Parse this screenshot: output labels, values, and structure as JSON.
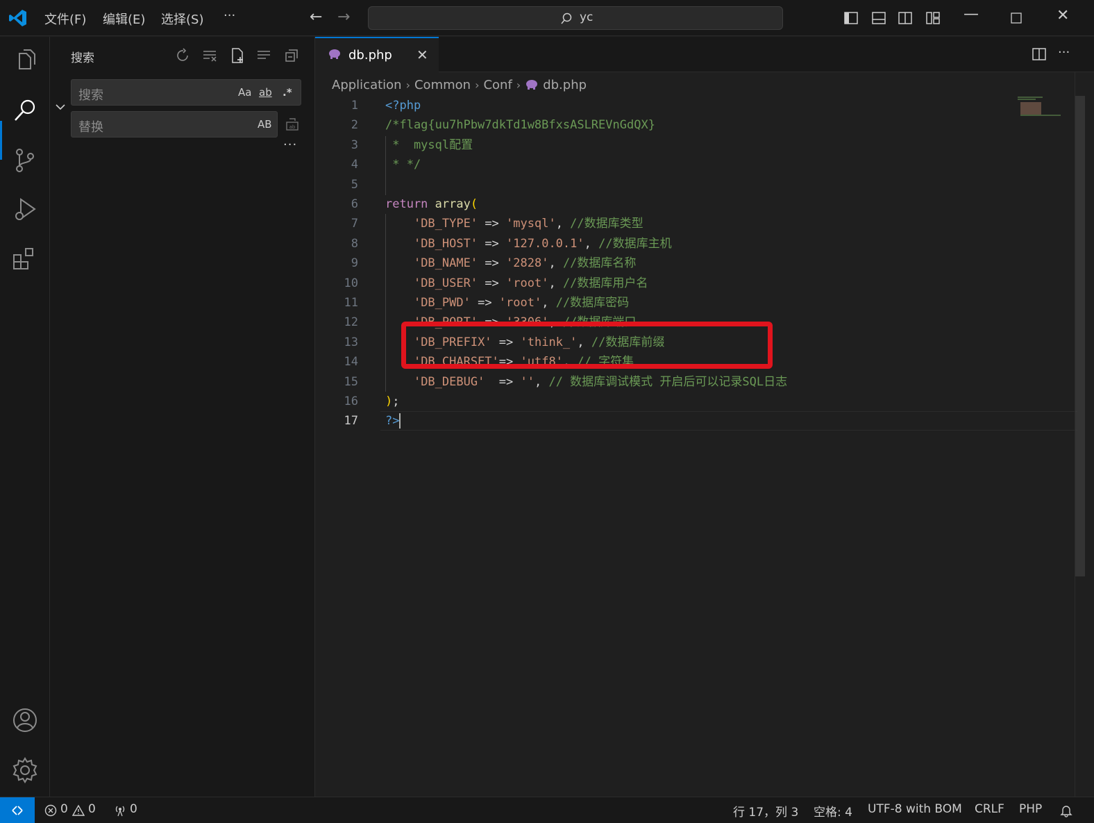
{
  "titlebar": {
    "menu": [
      "文件(F)",
      "编辑(E)",
      "选择(S)",
      "···"
    ],
    "search_label": "yc"
  },
  "sidebar": {
    "title": "搜索",
    "search_placeholder": "搜索",
    "replace_placeholder": "替换",
    "opt_case": "Aa",
    "opt_word": "ab",
    "opt_regex": ".*",
    "opt_preserve_case": "AB",
    "more": "···"
  },
  "tab": {
    "label": "db.php",
    "close": "✕"
  },
  "breadcrumb": [
    "Application",
    "Common",
    "Conf",
    "db.php"
  ],
  "editor": {
    "lines": [
      {
        "n": "1",
        "tokens": [
          {
            "t": "<?php",
            "c": "tag"
          }
        ]
      },
      {
        "n": "2",
        "tokens": [
          {
            "t": "/*flag{uu7hPbw7dkTd1w8BfxsASLREVnGdQX}",
            "c": "comment"
          }
        ]
      },
      {
        "n": "3",
        "tokens": [
          {
            "t": " *  mysql配置",
            "c": "comment"
          }
        ]
      },
      {
        "n": "4",
        "tokens": [
          {
            "t": " * */",
            "c": "comment"
          }
        ]
      },
      {
        "n": "5",
        "tokens": []
      },
      {
        "n": "6",
        "tokens": [
          {
            "t": "return",
            "c": "kw"
          },
          {
            "t": " ",
            "c": "op"
          },
          {
            "t": "array",
            "c": "fn"
          },
          {
            "t": "(",
            "c": "paren"
          }
        ]
      },
      {
        "n": "7",
        "tokens": [
          {
            "t": "    ",
            "c": "op"
          },
          {
            "t": "'DB_TYPE'",
            "c": "str"
          },
          {
            "t": " => ",
            "c": "op"
          },
          {
            "t": "'mysql'",
            "c": "str"
          },
          {
            "t": ", ",
            "c": "op"
          },
          {
            "t": "//数据库类型",
            "c": "comment"
          }
        ]
      },
      {
        "n": "8",
        "tokens": [
          {
            "t": "    ",
            "c": "op"
          },
          {
            "t": "'DB_HOST'",
            "c": "str"
          },
          {
            "t": " => ",
            "c": "op"
          },
          {
            "t": "'127.0.0.1'",
            "c": "str"
          },
          {
            "t": ", ",
            "c": "op"
          },
          {
            "t": "//数据库主机",
            "c": "comment"
          }
        ]
      },
      {
        "n": "9",
        "tokens": [
          {
            "t": "    ",
            "c": "op"
          },
          {
            "t": "'DB_NAME'",
            "c": "str"
          },
          {
            "t": " => ",
            "c": "op"
          },
          {
            "t": "'2828'",
            "c": "str"
          },
          {
            "t": ", ",
            "c": "op"
          },
          {
            "t": "//数据库名称",
            "c": "comment"
          }
        ]
      },
      {
        "n": "10",
        "tokens": [
          {
            "t": "    ",
            "c": "op"
          },
          {
            "t": "'DB_USER'",
            "c": "str"
          },
          {
            "t": " => ",
            "c": "op"
          },
          {
            "t": "'root'",
            "c": "str"
          },
          {
            "t": ", ",
            "c": "op"
          },
          {
            "t": "//数据库用户名",
            "c": "comment"
          }
        ]
      },
      {
        "n": "11",
        "tokens": [
          {
            "t": "    ",
            "c": "op"
          },
          {
            "t": "'DB_PWD'",
            "c": "str"
          },
          {
            "t": " => ",
            "c": "op"
          },
          {
            "t": "'root'",
            "c": "str"
          },
          {
            "t": ", ",
            "c": "op"
          },
          {
            "t": "//数据库密码",
            "c": "comment"
          }
        ]
      },
      {
        "n": "12",
        "tokens": [
          {
            "t": "    ",
            "c": "op"
          },
          {
            "t": "'DB_PORT'",
            "c": "str"
          },
          {
            "t": " => ",
            "c": "op"
          },
          {
            "t": "'3306'",
            "c": "str"
          },
          {
            "t": ", ",
            "c": "op"
          },
          {
            "t": "//数据库端口",
            "c": "comment"
          }
        ]
      },
      {
        "n": "13",
        "tokens": [
          {
            "t": "    ",
            "c": "op"
          },
          {
            "t": "'DB_PREFIX'",
            "c": "str"
          },
          {
            "t": " => ",
            "c": "op"
          },
          {
            "t": "'think_'",
            "c": "str"
          },
          {
            "t": ", ",
            "c": "op"
          },
          {
            "t": "//数据库前缀",
            "c": "comment"
          }
        ]
      },
      {
        "n": "14",
        "tokens": [
          {
            "t": "    ",
            "c": "op"
          },
          {
            "t": "'DB_CHARSET'",
            "c": "str"
          },
          {
            "t": "=> ",
            "c": "op"
          },
          {
            "t": "'utf8'",
            "c": "str"
          },
          {
            "t": ", ",
            "c": "op"
          },
          {
            "t": "// 字符集",
            "c": "comment"
          }
        ]
      },
      {
        "n": "15",
        "tokens": [
          {
            "t": "    ",
            "c": "op"
          },
          {
            "t": "'DB_DEBUG'",
            "c": "str"
          },
          {
            "t": "  => ",
            "c": "op"
          },
          {
            "t": "''",
            "c": "str"
          },
          {
            "t": ", ",
            "c": "op"
          },
          {
            "t": "// 数据库调试模式 开启后可以记录SQL日志",
            "c": "comment"
          }
        ]
      },
      {
        "n": "16",
        "tokens": [
          {
            "t": ")",
            "c": "paren"
          },
          {
            "t": ";",
            "c": "op"
          }
        ]
      },
      {
        "n": "17",
        "tokens": [
          {
            "t": "?>",
            "c": "tag"
          }
        ],
        "cursor": true
      }
    ]
  },
  "statusbar": {
    "errors": "0",
    "warnings": "0",
    "ports": "0",
    "position": "行 17，列 3",
    "spaces": "空格: 4",
    "encoding": "UTF-8 with BOM",
    "eol": "CRLF",
    "language": "PHP"
  },
  "colors": {
    "accent": "#0078d4",
    "highlight_box": "#e0141d"
  }
}
